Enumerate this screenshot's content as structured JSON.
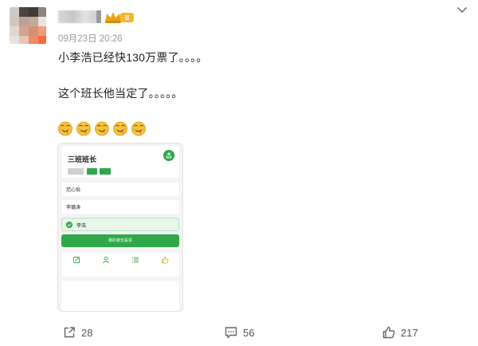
{
  "post": {
    "timestamp": "09月23日 20:26",
    "text_line1": "小李浩已经快130万票了。。。。",
    "text_line2": "这个班长他当定了。。。。。",
    "emoji": [
      "smirk-emoji",
      "smirk-emoji",
      "smirk-emoji",
      "smirk-emoji",
      "smirk-emoji"
    ]
  },
  "user": {
    "name_visible_char": "",
    "badge": "II"
  },
  "embedded_image": {
    "title": "三班班长",
    "tags": [
      "",
      "",
      ""
    ],
    "candidates": [
      {
        "name": "范心怡",
        "stats": "",
        "selected": false
      },
      {
        "name": "李璐涛",
        "stats": "",
        "selected": false
      },
      {
        "name": "李浩",
        "stats": "",
        "selected": true
      }
    ],
    "vote_button": "我的家长投票",
    "actions": [
      {
        "icon": "edit-icon",
        "label": ""
      },
      {
        "icon": "user-icon",
        "label": ""
      },
      {
        "icon": "list-icon",
        "label": ""
      },
      {
        "icon": "thumbs-up-icon",
        "label": ""
      }
    ],
    "description_lines": [
      "",
      "",
      "",
      "",
      ""
    ]
  },
  "actions": {
    "share_count": "28",
    "comment_count": "56",
    "like_count": "217"
  },
  "colors": {
    "accent_green": "#2fa84a",
    "badge_gold": "#e8a317",
    "text_muted": "#9a9a9a"
  }
}
